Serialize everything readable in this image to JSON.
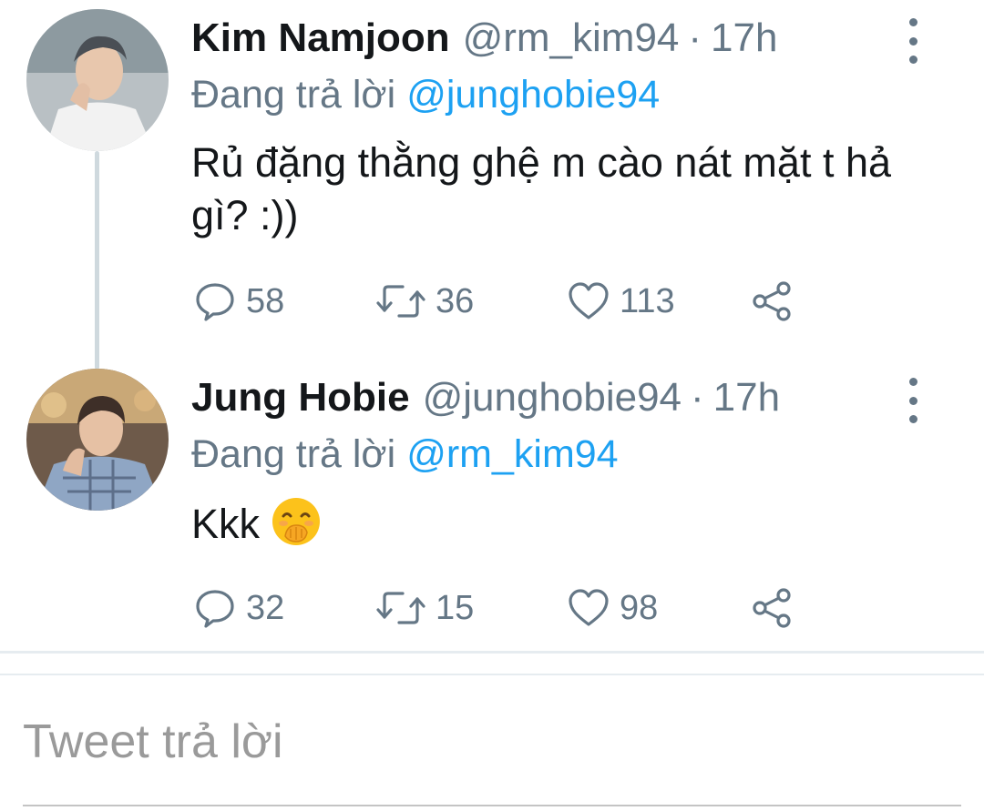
{
  "tweets": [
    {
      "name": "Kim Namjoon",
      "handle": "@rm_kim94",
      "separator": "·",
      "time": "17h",
      "reply_prefix": "Đang trả lời",
      "reply_mention": "@junghobie94",
      "text": "Rủ đặng thằng ghệ m cào nát mặt t hả gì? :))",
      "replies": "58",
      "retweets": "36",
      "likes": "113"
    },
    {
      "name": "Jung Hobie",
      "handle": "@junghobie94",
      "separator": "·",
      "time": "17h",
      "reply_prefix": "Đang trả lời",
      "reply_mention": "@rm_kim94",
      "text": "Kkk",
      "emoji": "face-with-hand-over-mouth",
      "replies": "32",
      "retweets": "15",
      "likes": "98"
    }
  ],
  "reply_box": {
    "placeholder": "Tweet trả lời"
  },
  "icons": {
    "reply": "reply-icon",
    "retweet": "retweet-icon",
    "like": "heart-icon",
    "share": "share-icon",
    "more": "more-vertical-icon"
  },
  "colors": {
    "link": "#1da1f2",
    "secondary_text": "#657786",
    "primary_text": "#14171a",
    "thread_line": "#cfd9de"
  }
}
